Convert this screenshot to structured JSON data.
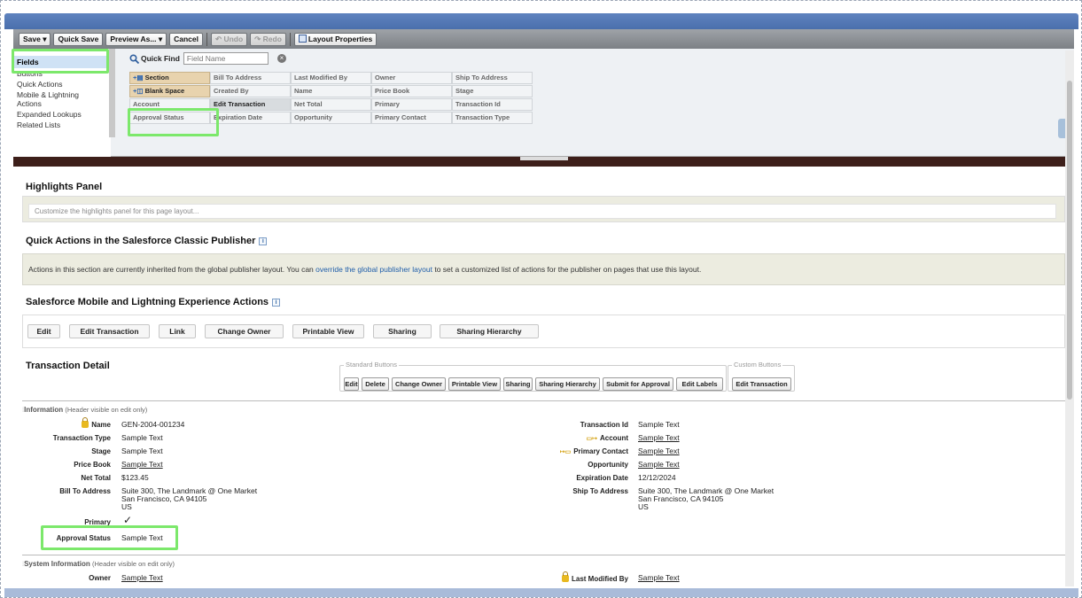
{
  "toolbar": {
    "save": "Save ▾",
    "quick_save": "Quick Save",
    "preview_as": "Preview As... ▾",
    "cancel": "Cancel",
    "undo": "↶ Undo",
    "redo": "↷ Redo",
    "layout_properties": "Layout Properties"
  },
  "palette": {
    "categories": [
      "Fields",
      "Buttons",
      "Quick Actions",
      "Mobile & Lightning Actions",
      "Expanded Lookups",
      "Related Lists"
    ],
    "quick_find_label": "Quick Find",
    "quick_find_placeholder": "Field Name",
    "fields": [
      [
        "Section",
        "Bill To Address",
        "Last Modified By",
        "Owner",
        "Ship To Address"
      ],
      [
        "Blank Space",
        "Created By",
        "Name",
        "Price Book",
        "Stage"
      ],
      [
        "Account",
        "Edit Transaction",
        "Net Total",
        "Primary",
        "Transaction Id"
      ],
      [
        "Approval Status",
        "Expiration Date",
        "Opportunity",
        "Primary Contact",
        "Transaction Type"
      ]
    ]
  },
  "highlights": {
    "title": "Highlights Panel",
    "placeholder": "Customize the highlights panel for this page layout..."
  },
  "quick_actions": {
    "title": "Quick Actions in the Salesforce Classic Publisher",
    "text_before": "Actions in this section are currently inherited from the global publisher layout. You can ",
    "link": "override the global publisher layout",
    "text_after": " to set a customized list of actions for the publisher on pages that use this layout."
  },
  "mobile_actions": {
    "title": "Salesforce Mobile and Lightning Experience Actions",
    "buttons": [
      "Edit",
      "Edit Transaction",
      "Link",
      "Change Owner",
      "Printable View",
      "Sharing",
      "Sharing Hierarchy"
    ]
  },
  "detail": {
    "title": "Transaction Detail",
    "standard_legend": "Standard Buttons",
    "standard_buttons": [
      "Edit",
      "Delete",
      "Change Owner",
      "Printable View",
      "Sharing",
      "Sharing Hierarchy",
      "Submit for Approval",
      "Edit Labels"
    ],
    "custom_legend": "Custom Buttons",
    "custom_buttons": [
      "Edit Transaction"
    ]
  },
  "information": {
    "header": "Information",
    "header_note": "(Header visible on edit only)",
    "left": [
      {
        "label": "Name",
        "value": "GEN-2004-001234"
      },
      {
        "label": "Transaction Type",
        "value": "Sample Text"
      },
      {
        "label": "Stage",
        "value": "Sample Text"
      },
      {
        "label": "Price Book",
        "value": "Sample Text"
      },
      {
        "label": "Net Total",
        "value": "$123.45"
      },
      {
        "label": "Bill To Address",
        "value_lines": [
          "Suite 300, The Landmark @ One Market",
          "San Francisco, CA 94105",
          "US"
        ]
      },
      {
        "label": "Primary",
        "value": "✓"
      },
      {
        "label": "Approval Status",
        "value": "Sample Text"
      }
    ],
    "right": [
      {
        "label": "Transaction Id",
        "value": "Sample Text"
      },
      {
        "label": "Account",
        "value": "Sample Text"
      },
      {
        "label": "Primary Contact",
        "value": "Sample Text"
      },
      {
        "label": "Opportunity",
        "value": "Sample Text"
      },
      {
        "label": "Expiration Date",
        "value": "12/12/2024"
      },
      {
        "label": "Ship To Address",
        "value_lines": [
          "Suite 300, The Landmark @ One Market",
          "San Francisco, CA 94105",
          "US"
        ]
      }
    ]
  },
  "system_information": {
    "header": "System Information",
    "header_note": "(Header visible on edit only)",
    "owner_label": "Owner",
    "owner_value": "Sample Text",
    "last_modified_label": "Last Modified By",
    "last_modified_value": "Sample Text"
  },
  "colors": {
    "highlight": "#7ce86b",
    "top_band": "#5f83bf",
    "split_bar": "#3d1f1a",
    "link": "#1f5da9"
  }
}
